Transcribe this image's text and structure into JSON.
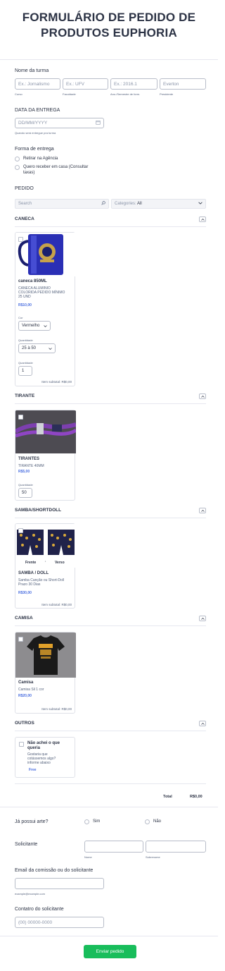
{
  "form": {
    "title_line1": "FORMULÁRIO DE PEDIDO DE",
    "title_line2": "PRODUTOS EUPHORIA"
  },
  "turma": {
    "label": "Nome da turma",
    "fields": [
      {
        "placeholder": "Ex.: Jornalismo",
        "sublabel": "Curso"
      },
      {
        "placeholder": "Ex.: UFV",
        "sublabel": "Faculdade"
      },
      {
        "placeholder": "Ex.: 2016.1",
        "sublabel": "Ano./Semestre de form."
      },
      {
        "placeholder": "Everton",
        "sublabel": "Presidente"
      }
    ]
  },
  "entrega": {
    "label": "DATA DA ENTREGA",
    "placeholder": "DD/MM/YYYY",
    "sublabel": "Quando será entregue pra turma"
  },
  "forma": {
    "label": "Forma de entrega",
    "option1": "Retirar na Agência",
    "option2_line1": "Quero receber em casa (Consultar",
    "option2_line2": "taxas)"
  },
  "pedido": {
    "label": "PEDIDO",
    "search_placeholder": "Search",
    "categories_label": "Categories:",
    "categories_value": "All"
  },
  "sections": {
    "caneca": "CANECA",
    "tirante": "TIRANTE",
    "samba": "SAMBA/SHORTDOLL",
    "camisa": "CAMISA",
    "outros": "OUTROS"
  },
  "products": {
    "caneca": {
      "name": "caneca 850ML",
      "desc1": "CANECA ALUMINIO",
      "desc2": "COLORIDA PEDIDO MÍNIMO",
      "desc3": "25 UND",
      "price": "R$10,00",
      "cor_label": "Cor",
      "cor_value": "Vermelho",
      "qtd_label": "Quantidade",
      "qtd_value": "25 à 50",
      "qtd2_label": "Quantidade",
      "qtd2_value": "1",
      "subtotal": "Item subtotal: R$0,00"
    },
    "tirantes": {
      "name": "TIRANTES",
      "desc1": "TIRANTE 40MM",
      "price": "R$5,00",
      "qtd_label": "Quantidade",
      "qtd_value": "50"
    },
    "samba": {
      "name": "SAMBA / DOLL",
      "desc1": "Samba Canção ou Short-Doll",
      "desc2": "Prazo 30 Dias",
      "price": "R$30,00",
      "subtotal": "Item subtotal: R$0,00",
      "img_front": "Frente",
      "img_back": "Verso"
    },
    "camisa": {
      "name": "Camisa",
      "desc1": "Camisa Sil 1 cor",
      "price": "R$20,00",
      "subtotal": "Item subtotal: R$0,00"
    },
    "outros": {
      "name1": "Não achei o que",
      "name2": "queria",
      "desc1": "Gostaria que",
      "desc2": "cotássemos algo?",
      "desc3": "informe abaixo",
      "price": "Free"
    }
  },
  "total": {
    "label": "Total",
    "value": "R$0,00"
  },
  "arte": {
    "label": "Já possui arte?",
    "yes": "Sim",
    "no": "Não"
  },
  "solicitante": {
    "label": "Solicitante",
    "first_sublabel": "Nome",
    "last_sublabel": "Sobrenome"
  },
  "email": {
    "label": "Email da comissão ou do solicitante",
    "sublabel": "example@example.com"
  },
  "contato": {
    "label": "Contatro do solicitante",
    "placeholder": "(00) 00000-0000"
  },
  "submit": {
    "label": "Enviar pedido"
  },
  "colors": {
    "accent_green": "#18bd5b",
    "price_blue": "#4a6ee0",
    "text_dark": "#2c3345"
  }
}
